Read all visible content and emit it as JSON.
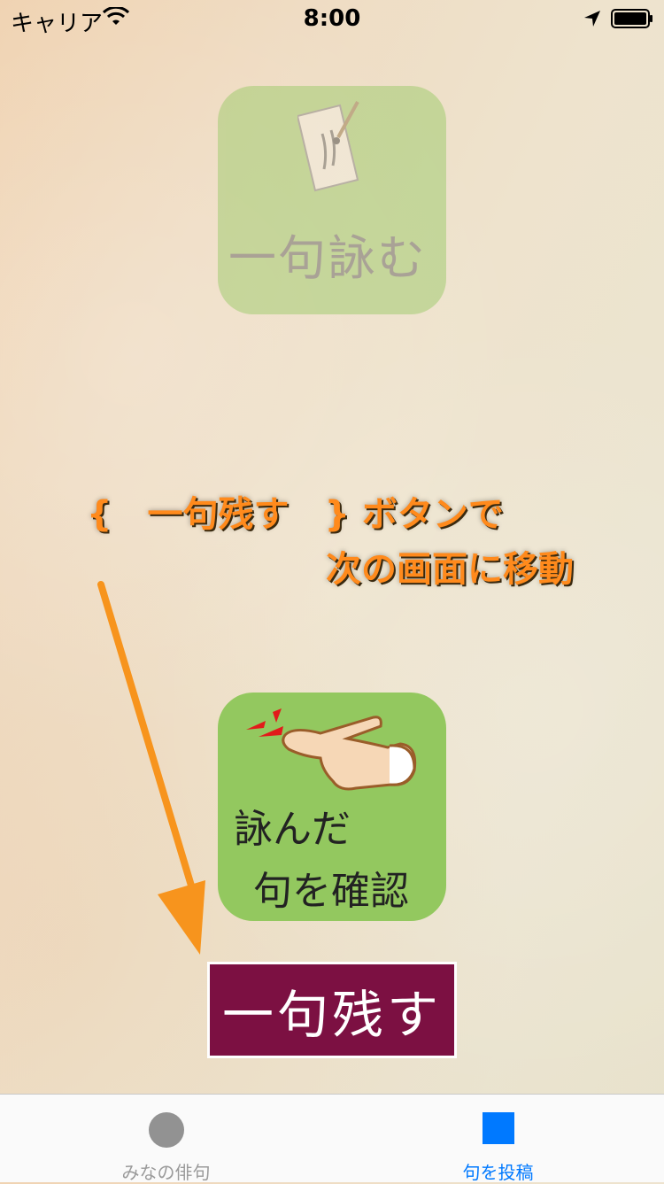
{
  "status_bar": {
    "carrier": "キャリア",
    "time": "8:00"
  },
  "tiles": {
    "compose": {
      "label": "一句詠む"
    },
    "confirm": {
      "line1": "詠んだ",
      "line2": "句を確認"
    }
  },
  "callout": {
    "line1": "{　一句残す　} ボタンで",
    "line2": "次の画面に移動"
  },
  "leave_button": {
    "label": "一句残す"
  },
  "tabbar": {
    "tabs": [
      {
        "label": "みなの俳句",
        "icon": "circle-icon",
        "selected": false
      },
      {
        "label": "句を投稿",
        "icon": "square-icon",
        "selected": true
      }
    ]
  },
  "colors": {
    "tile_green": "#93c85f",
    "button_bg": "#7c1042",
    "callout_orange": "#ff8a1c",
    "tab_active": "#0079ff",
    "tab_inactive": "#929292"
  }
}
